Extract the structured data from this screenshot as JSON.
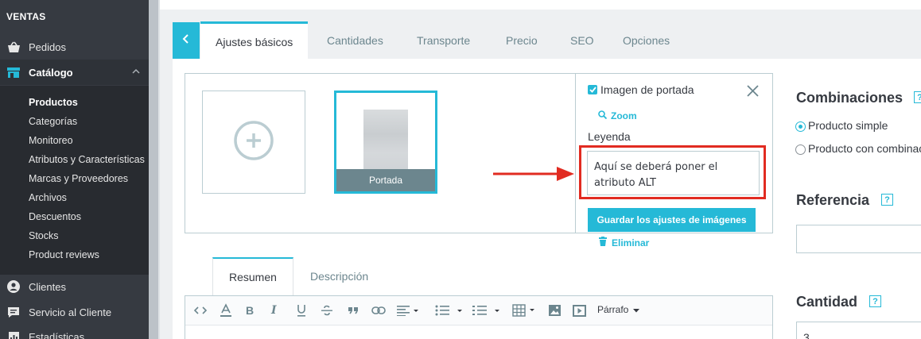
{
  "sidebar": {
    "section_title": "VENTAS",
    "items": [
      {
        "label": "Pedidos",
        "icon": "basket-icon"
      },
      {
        "label": "Catálogo",
        "icon": "store-icon"
      },
      {
        "label": "Clientes",
        "icon": "user-icon"
      },
      {
        "label": "Servicio al Cliente",
        "icon": "chat-icon"
      },
      {
        "label": "Estadísticas",
        "icon": "chart-icon"
      }
    ],
    "catalog_subitems": [
      "Productos",
      "Categorías",
      "Monitoreo",
      "Atributos y Características",
      "Marcas y Proveedores",
      "Archivos",
      "Descuentos",
      "Stocks",
      "Product reviews"
    ]
  },
  "tabs": [
    "Ajustes básicos",
    "Cantidades",
    "Transporte",
    "Precio",
    "SEO",
    "Opciones"
  ],
  "images": {
    "cover_caption": "Portada"
  },
  "image_settings": {
    "cover_checkbox_label": "Imagen de portada",
    "cover_checked": true,
    "zoom_label": "Zoom",
    "legend_label": "Leyenda",
    "legend_value": "Aquí se deberá poner el atributo ALT",
    "save_button": "Guardar los ajustes de imágenes",
    "delete_label": "Eliminar"
  },
  "right_column": {
    "combinations_title": "Combinaciones",
    "help_icon": "?",
    "radio_simple": "Producto simple",
    "radio_combinations": "Producto con combinaciones",
    "reference_title": "Referencia",
    "reference_value": "",
    "quantity_title": "Cantidad",
    "quantity_value": "3"
  },
  "description_tabs": [
    "Resumen",
    "Descripción"
  ],
  "editor": {
    "paragraph_label": "Párrafo"
  },
  "colors": {
    "accent": "#25b9d7",
    "sidebar_bg": "#363a41",
    "highlight_red": "#e12b21"
  }
}
